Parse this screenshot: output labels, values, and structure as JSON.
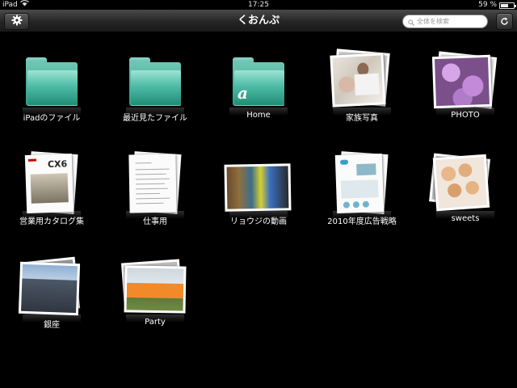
{
  "status_bar": {
    "device": "iPad",
    "time": "17:25",
    "battery": "59 %",
    "battery_level": 0.59
  },
  "nav": {
    "title": "くおんぷ",
    "search_placeholder": "全体を検索"
  },
  "items": [
    {
      "label": "iPadのファイル",
      "kind": "folder"
    },
    {
      "label": "最近見たファイル",
      "kind": "folder"
    },
    {
      "label": "Home",
      "kind": "folder",
      "glyph": "a"
    },
    {
      "label": "家族写真",
      "kind": "photos"
    },
    {
      "label": "PHOTO",
      "kind": "photos"
    },
    {
      "label": "営業用カタログ集",
      "kind": "documents",
      "doc_text": "CX6"
    },
    {
      "label": "仕事用",
      "kind": "documents"
    },
    {
      "label": "リョウジの動画",
      "kind": "videos"
    },
    {
      "label": "2010年度広告戦略",
      "kind": "documents"
    },
    {
      "label": "sweets",
      "kind": "photos"
    },
    {
      "label": "銀座",
      "kind": "photos"
    },
    {
      "label": "Party",
      "kind": "photos"
    }
  ],
  "colors": {
    "folder_teal": "#3fae97",
    "nav_bg": "#2a2a2a",
    "background": "#000000"
  }
}
